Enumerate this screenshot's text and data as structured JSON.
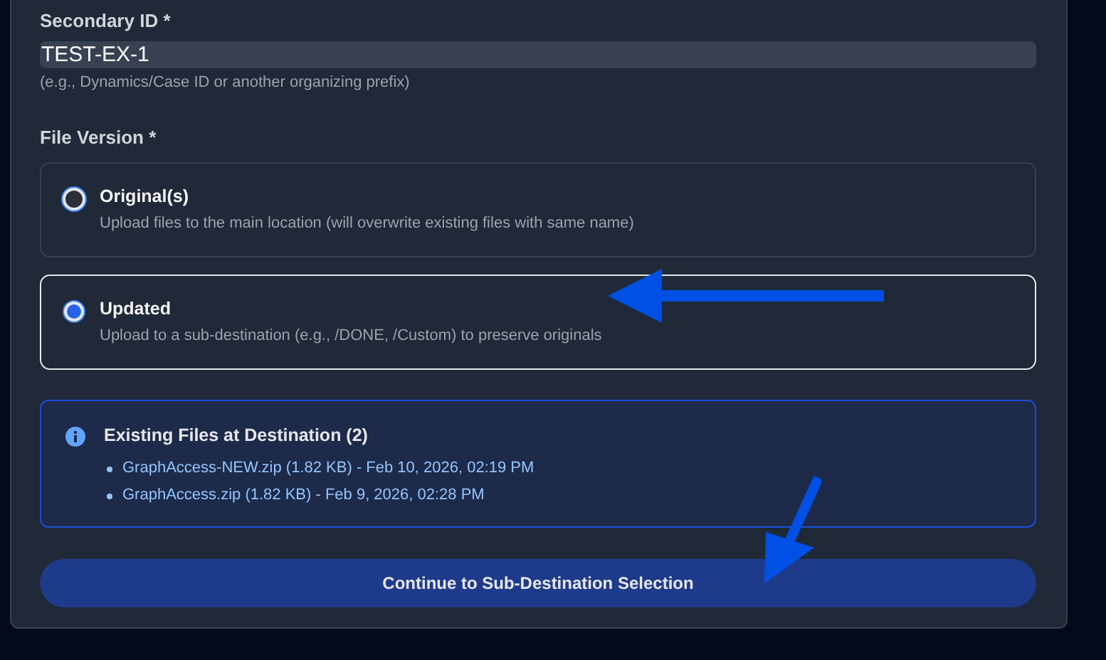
{
  "secondary_id": {
    "label": "Secondary ID *",
    "value": "TEST-EX-1",
    "hint": "(e.g., Dynamics/Case ID or another organizing prefix)"
  },
  "file_version": {
    "label": "File Version *",
    "options": [
      {
        "title": "Original(s)",
        "description": "Upload files to the main location (will overwrite existing files with same name)",
        "selected": false
      },
      {
        "title": "Updated",
        "description": "Upload to a sub-destination (e.g., /DONE, /Custom) to preserve originals",
        "selected": true
      }
    ]
  },
  "existing_files": {
    "title": "Existing Files at Destination (2)",
    "files": [
      "GraphAccess-NEW.zip (1.82 KB) - Feb 10, 2026, 02:19 PM",
      "GraphAccess.zip (1.82 KB) - Feb 9, 2026, 02:28 PM"
    ]
  },
  "continue_button": "Continue to Sub-Destination Selection"
}
